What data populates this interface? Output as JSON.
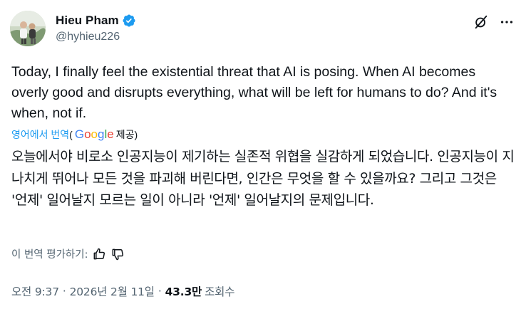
{
  "author": {
    "display_name": "Hieu Pham",
    "handle": "@hyhieu226",
    "verified": true
  },
  "icons": {
    "verified": "verified-badge-icon",
    "grok": "grok-icon",
    "more": "more-options-icon",
    "like": "thumbs-up-icon",
    "dislike": "thumbs-down-icon"
  },
  "colors": {
    "accent": "#1d9bf0",
    "text": "#0f1419",
    "muted": "#536471"
  },
  "tweet": {
    "text": "Today, I finally feel the existential threat that AI is posing. When AI becomes overly good and disrupts everything, what will be left for humans to do? And it's when, not if."
  },
  "translation": {
    "translated_from_label": "영어에서 번역",
    "open_paren": "(",
    "google": "Google",
    "provided_label": " 제공)",
    "text": "오늘에서야 비로소 인공지능이 제기하는 실존적 위협을 실감하게 되었습니다. 인공지능이 지나치게 뛰어나 모든 것을 파괴해 버린다면, 인간은 무엇을 할 수 있을까요? 그리고 그것은 '언제' 일어날지 모르는 일이 아니라 '언제' 일어날지의 문제입니다.",
    "rate_label": "이 번역 평가하기:"
  },
  "meta": {
    "time": "오전 9:37",
    "separator": "·",
    "date": "2026년 2월 11일",
    "views_count": "43.3만",
    "views_label": "조회수"
  }
}
